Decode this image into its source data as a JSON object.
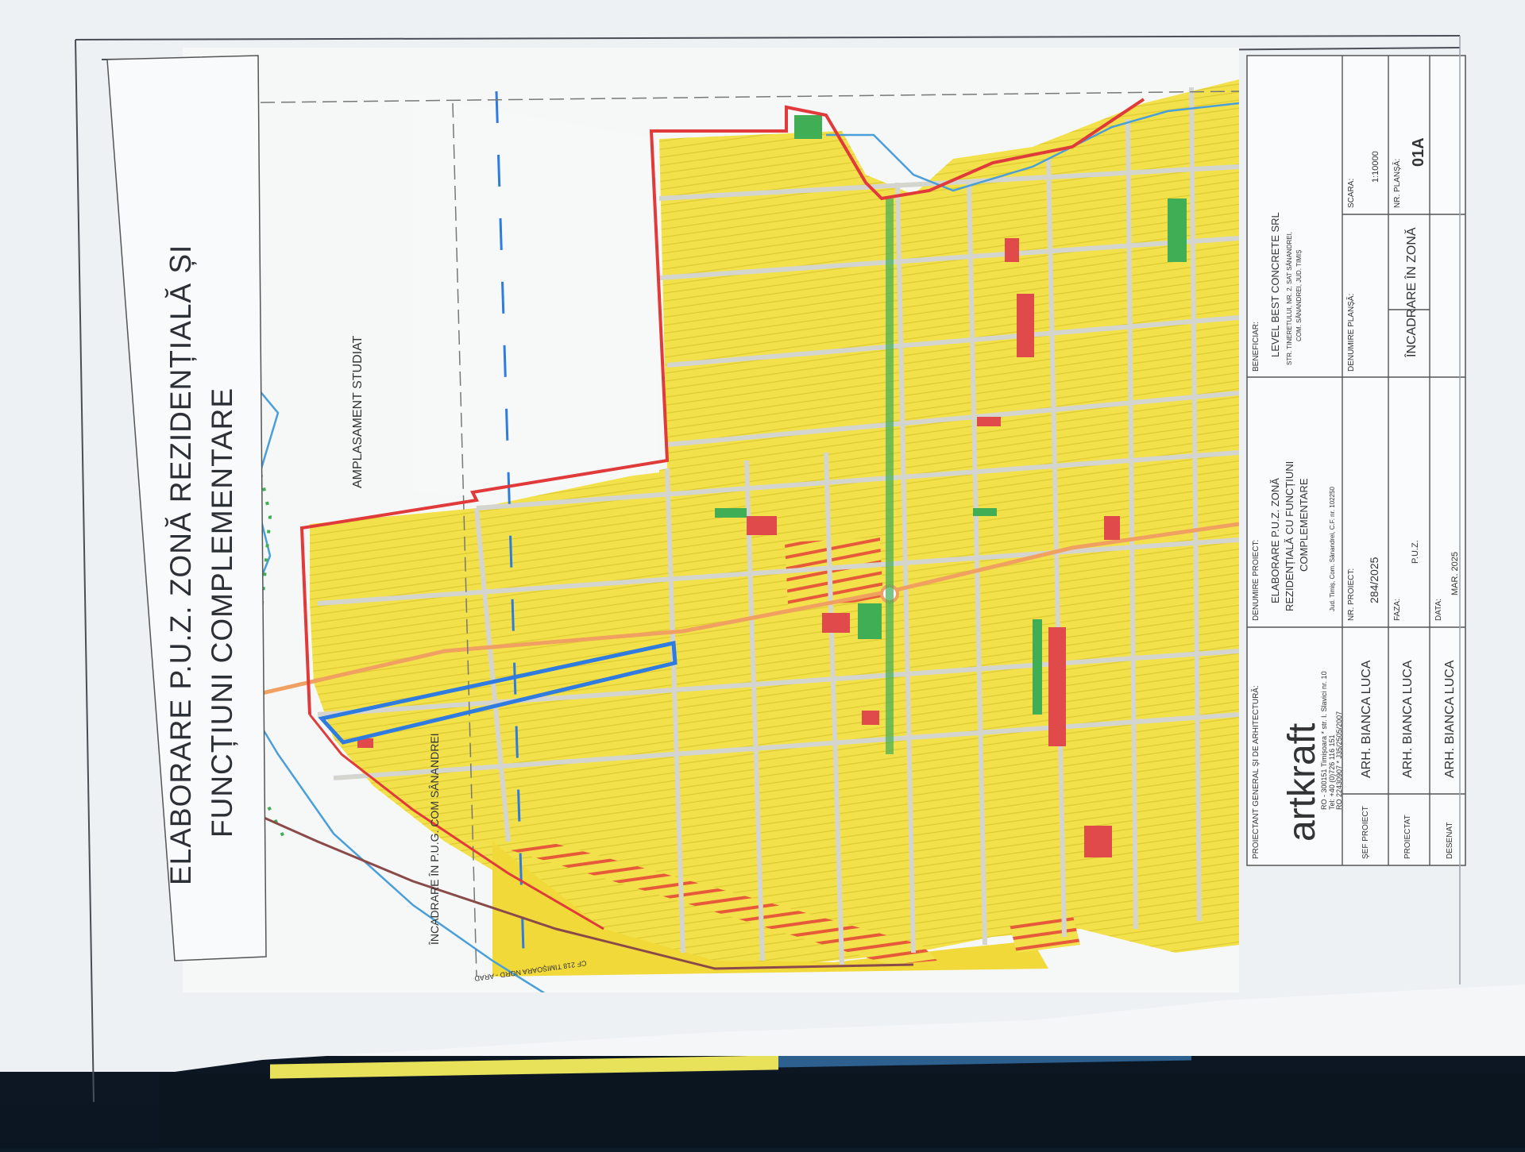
{
  "title": {
    "line1": "ELABORARE P.U.Z. ZONĂ REZIDENȚIALĂ ȘI",
    "line2": "FUNCȚIUNI COMPLEMENTARE"
  },
  "map_labels": {
    "amplasament": "AMPLASAMENT STUDIAT",
    "incadrare": "ÎNCADRARE ÎN P.U.G. COM SÂNANDREI",
    "railway": "CF 218 TIMIȘOARA NORD - ARAD"
  },
  "title_block": {
    "proiectant_label": "PROIECTANT GENERAL ȘI DE ARHITECTURĂ:",
    "logo": "artkraft",
    "address_1": "RO - 300151 Timișoara * str. I. Slavici nr. 10",
    "address_2": "Tel: +40 (0)726 116 151",
    "address_3": "RO 22430907 * J35/2505/2007",
    "project_label": "DENUMIRE PROIECT:",
    "project_1": "ELABORARE P.U.Z. ZONĂ",
    "project_2": "REZIDENȚIALĂ CU FUNCȚIUNI",
    "project_3": "COMPLEMENTARE",
    "project_4": "Jud. Timiș, Com. Sânandrei, C.F. nr. 102250",
    "beneficiar_label": "BENEFICIAR:",
    "beneficiar_1": "LEVEL BEST CONCRETE SRL",
    "beneficiar_2": "STR. TINERETULUI, NR. 2, SAT SÂNANDREI,",
    "beneficiar_3": "COM. SÂNANDREI, JUD. TIMIȘ",
    "sef_label": "ȘEF PROIECT",
    "sef_name": "ARH. BIANCA LUCA",
    "nr_proiect_label": "NR. PROIECT:",
    "nr_proiect": "284/2025",
    "denumire_plansa_label": "DENUMIRE PLANȘĂ:",
    "denumire_plansa": "ÎNCADRARE ÎN ZONĂ",
    "scara_label": "SCARA:",
    "scara": "1:10000",
    "proiectat_label": "PROIECTAT",
    "proiectat_name": "ARH. BIANCA LUCA",
    "faza_label": "FAZA:",
    "faza": "P.U.Z.",
    "nr_plansa_label": "NR. PLANȘĂ:",
    "nr_plansa": "01A",
    "desenat_label": "DESENAT",
    "desenat_name": "ARH. BIANCA LUCA",
    "data_label": "DATA:",
    "data": "MAR. 2025"
  },
  "colors": {
    "residential": "#f2e14a",
    "boundary": "#e03a3a",
    "site": "#2f7be0",
    "green": "#3fae55",
    "road_main": "#f0a060",
    "water": "#4a9fd8"
  }
}
